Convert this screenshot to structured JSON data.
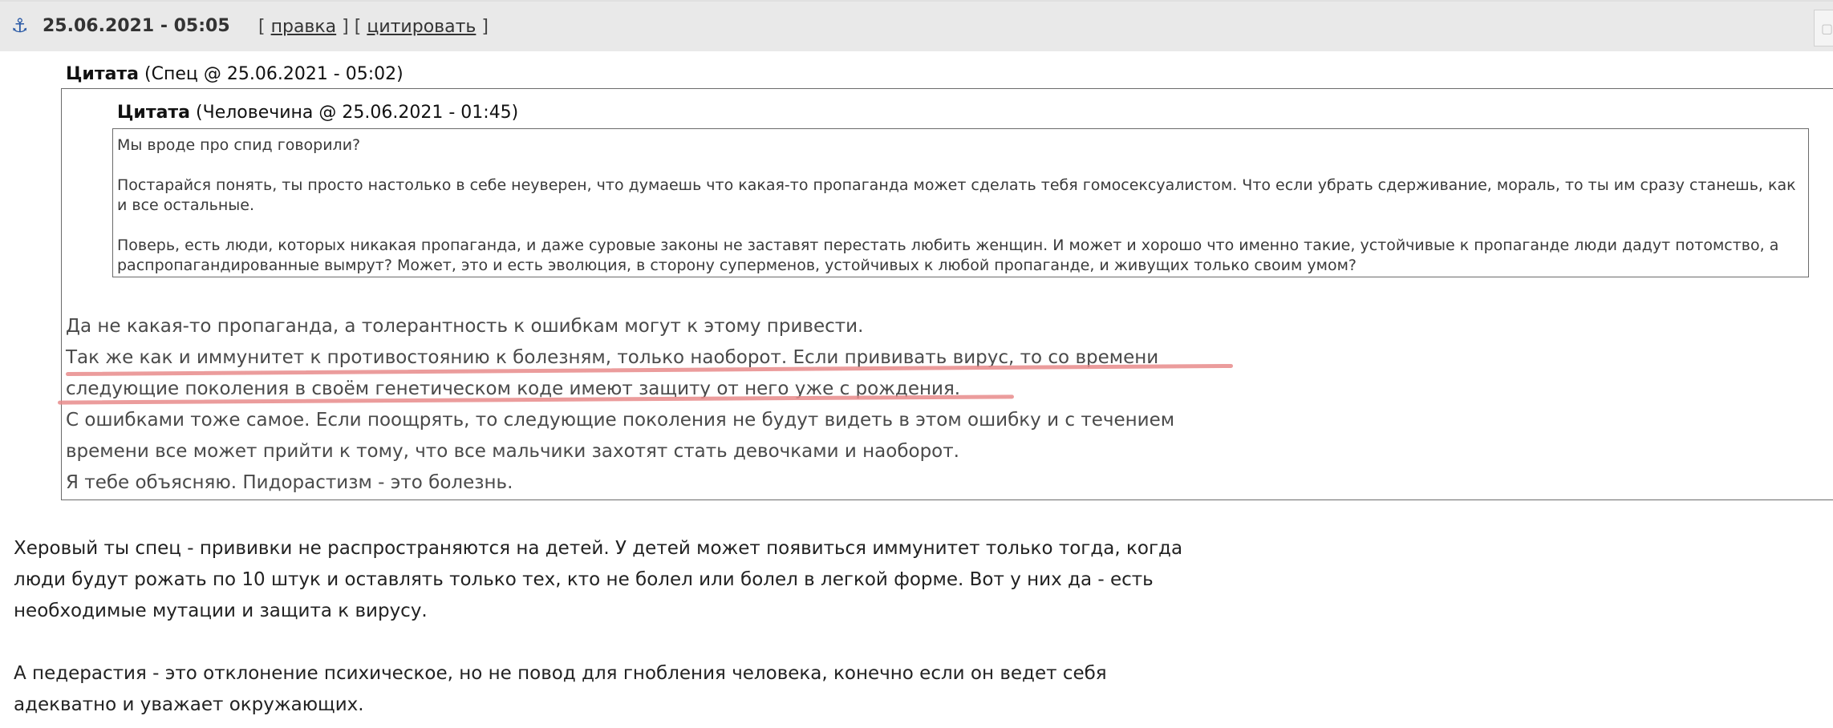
{
  "header": {
    "anchor_icon": "⚓",
    "date": "25.06.2021 - 05:05",
    "bracket_open_1": "[",
    "edit_label": "правка",
    "bracket_mid": "] [",
    "quote_label": "цитировать",
    "bracket_close": "]"
  },
  "outer_quote": {
    "label": "Цитата",
    "meta": " (Спец @ 25.06.2021 - 05:02)",
    "inner_quote": {
      "label": "Цитата",
      "meta": " (Человечина @ 25.06.2021 - 01:45)",
      "paragraphs": [
        "Мы вроде про спид говорили?",
        "Постарайся понять, ты просто настолько в себе неуверен, что думаешь что какая-то пропаганда может сделать тебя гомосексуалистом. Что если убрать сдерживание, мораль, то ты им сразу станешь, как и все остальные.",
        "Поверь, есть люди, которых никакая пропаганда, и даже суровые законы не заставят перестать любить женщин. И может и хорошо что именно такие, устойчивые к пропаганде люди дадут потомство, а распропагандированные вымрут? Может, это и есть эволюция, в сторону суперменов, устойчивых к любой пропаганде, и живущих только своим умом?"
      ]
    },
    "lines": [
      "Да не какая-то пропаганда, а толерантность к ошибкам могут к этому привести.",
      "Так же как и иммунитет к противостоянию к болезням, только наоборот. Если прививать вирус, то со времени",
      "следующие поколения в своём генетическом коде имеют защиту от него уже с рождения.",
      "С ошибками тоже самое. Если поощрять, то следующие поколения не будут видеть в этом ошибку и с течением",
      "времени все может прийти к тому, что все мальчики захотят стать девочками и наоборот.",
      "Я тебе объясняю. Пидорастизм - это болезнь."
    ]
  },
  "reply": {
    "lines": [
      "Херовый ты спец - прививки не распространяются на детей. У детей может появиться иммунитет только тогда, когда",
      "люди будут рожать по 10 штук и оставлять только тех, кто не болел или болел в легкой форме. Вот у них да - есть",
      "необходимые мутации и защита к вирусу.",
      "",
      "А педерастия - это отклонение психическое, но не повод для гнобления человека, конечно если он ведет себя",
      "адекватно и уважает окружающих."
    ]
  },
  "colors": {
    "header_bg": "#e9e9e9",
    "anchor": "#2a5aa6",
    "annotation_underline": "#e88b8b"
  }
}
